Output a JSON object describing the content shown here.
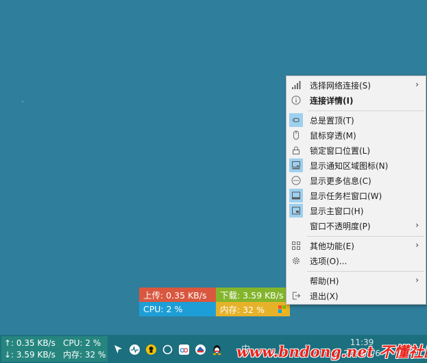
{
  "widget": {
    "upload": "上传: 0.35 KB/s",
    "download": "下载: 3.59 KB/s",
    "cpu": "CPU: 2 %",
    "memory": "内存: 32 %",
    "colors": {
      "upload": "#d9573f",
      "download": "#83b52c",
      "cpu": "#1e9ed6",
      "memory": "#e6b229"
    }
  },
  "menu": {
    "items": [
      {
        "label": "选择网络连接(S)",
        "icon": "signal-bars-icon",
        "submenu": true
      },
      {
        "label": "连接详情(I)",
        "icon": "info-icon",
        "bold": true
      },
      {
        "label": "总是置顶(T)",
        "icon": "pin-icon",
        "checked": true
      },
      {
        "label": "鼠标穿透(M)",
        "icon": "mouse-icon"
      },
      {
        "label": "锁定窗口位置(L)",
        "icon": "lock-icon"
      },
      {
        "label": "显示通知区域图标(N)",
        "icon": "notify-area-icon",
        "checked": true
      },
      {
        "label": "显示更多信息(C)",
        "icon": "more-info-icon"
      },
      {
        "label": "显示任务栏窗口(W)",
        "icon": "taskbar-window-icon",
        "checked": true
      },
      {
        "label": "显示主窗口(H)",
        "icon": "main-window-icon",
        "checked": true
      },
      {
        "label": "窗口不透明度(P)",
        "icon": "",
        "submenu": true
      },
      {
        "label": "其他功能(E)",
        "icon": "grid-icon",
        "submenu": true
      },
      {
        "label": "选项(O)...",
        "icon": "gear-icon"
      },
      {
        "label": "帮助(H)",
        "icon": "",
        "submenu": true
      },
      {
        "label": "退出(X)",
        "icon": "exit-icon"
      }
    ],
    "arrow": "›"
  },
  "taskbar": {
    "upload": "↑: 0.35 KB/s",
    "download": "↓: 3.59 KB/s",
    "cpu": "CPU: 2 %",
    "memory": "内存: 32 %",
    "time": "11:39",
    "date": "2020/5/6",
    "ime": "中"
  },
  "watermark": "www.bndong.net 不懂社区"
}
